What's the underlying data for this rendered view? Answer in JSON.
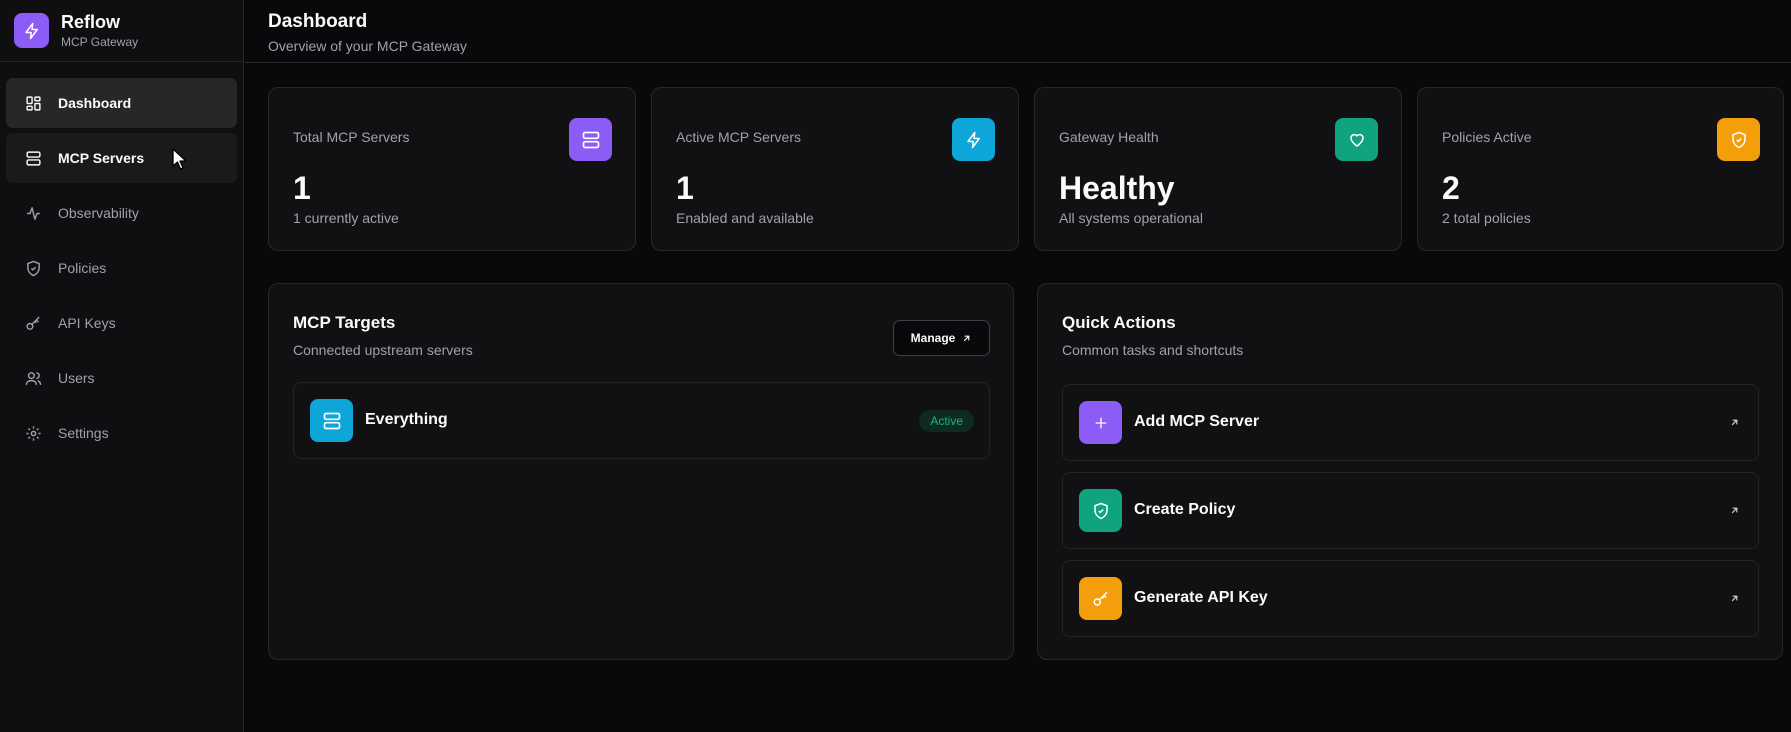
{
  "brand": {
    "name": "Reflow",
    "subtitle": "MCP Gateway"
  },
  "nav": [
    {
      "label": "Dashboard",
      "icon": "dashboard-icon",
      "state": "active"
    },
    {
      "label": "MCP Servers",
      "icon": "server-icon",
      "state": "hover"
    },
    {
      "label": "Observability",
      "icon": "activity-icon",
      "state": ""
    },
    {
      "label": "Policies",
      "icon": "shield-icon",
      "state": ""
    },
    {
      "label": "API Keys",
      "icon": "key-icon",
      "state": ""
    },
    {
      "label": "Users",
      "icon": "users-icon",
      "state": ""
    },
    {
      "label": "Settings",
      "icon": "gear-icon",
      "state": ""
    }
  ],
  "header": {
    "title": "Dashboard",
    "subtitle": "Overview of your MCP Gateway"
  },
  "stats": [
    {
      "label": "Total MCP Servers",
      "value": "1",
      "desc": "1 currently active",
      "icon": "server-icon",
      "color": "#8b5cf6"
    },
    {
      "label": "Active MCP Servers",
      "value": "1",
      "desc": "Enabled and available",
      "icon": "lightning-icon",
      "color": "#0ea5d8"
    },
    {
      "label": "Gateway Health",
      "value": "Healthy",
      "desc": "All systems operational",
      "icon": "heart-icon",
      "color": "#10a37f"
    },
    {
      "label": "Policies Active",
      "value": "2",
      "desc": "2 total policies",
      "icon": "shield-icon",
      "color": "#f59e0b"
    }
  ],
  "targets": {
    "title": "MCP Targets",
    "subtitle": "Connected upstream servers",
    "manage_label": "Manage",
    "items": [
      {
        "name": "Everything",
        "status": "Active",
        "icon": "server-icon",
        "color": "#0ea5d8"
      }
    ]
  },
  "quick_actions": {
    "title": "Quick Actions",
    "subtitle": "Common tasks and shortcuts",
    "items": [
      {
        "label": "Add MCP Server",
        "icon": "plus-icon",
        "color": "#8b5cf6"
      },
      {
        "label": "Create Policy",
        "icon": "shield-icon",
        "color": "#10a37f"
      },
      {
        "label": "Generate API Key",
        "icon": "key-icon",
        "color": "#f59e0b"
      }
    ]
  }
}
